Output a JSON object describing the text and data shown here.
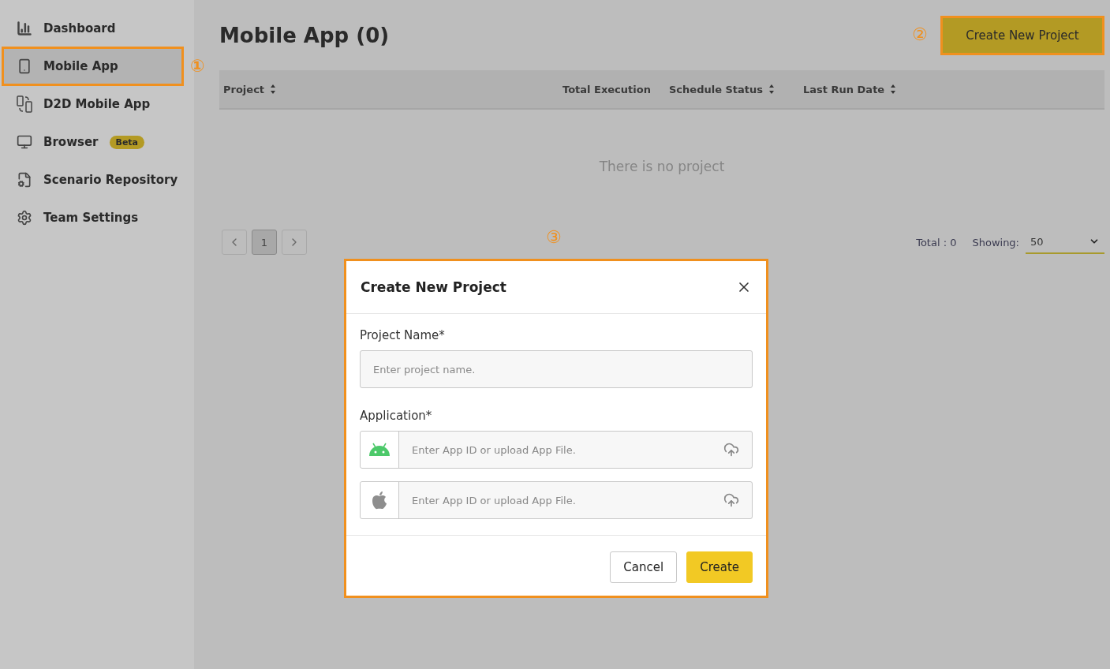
{
  "sidebar": {
    "items": [
      {
        "kind": "dashboard",
        "label": "Dashboard",
        "selected": false,
        "highlighted": false
      },
      {
        "kind": "mobile",
        "label": "Mobile App",
        "selected": true,
        "highlighted": true,
        "marker": "①"
      },
      {
        "kind": "d2d",
        "label": "D2D Mobile App",
        "selected": false,
        "highlighted": false
      },
      {
        "kind": "browser",
        "label": "Browser",
        "badge": "Beta",
        "selected": false,
        "highlighted": false
      },
      {
        "kind": "scenario",
        "label": "Scenario Repository",
        "selected": false,
        "highlighted": false
      },
      {
        "kind": "settings",
        "label": "Team Settings",
        "selected": false,
        "highlighted": false
      }
    ]
  },
  "page": {
    "title": "Mobile App (0)",
    "create_button": {
      "label": "Create New Project",
      "highlighted": true,
      "marker": "②"
    }
  },
  "table": {
    "columns": [
      {
        "label": "Project",
        "sortable": true
      },
      {
        "label": "Total Execution",
        "sortable": false
      },
      {
        "label": "Schedule Status",
        "sortable": true
      },
      {
        "label": "Last Run Date",
        "sortable": true
      }
    ],
    "empty_text": "There is no project"
  },
  "pagination": {
    "pages": [
      {
        "label": "1",
        "selected": true
      }
    ],
    "total": "Total : 0",
    "showing_label": "Showing:",
    "showing_value": "50"
  },
  "dialog": {
    "marker": "③",
    "highlighted": true,
    "title": "Create New Project",
    "fields": [
      {
        "label": "Project Name*",
        "inputs": [
          {
            "kind": "text",
            "placeholder": "Enter project name."
          }
        ]
      },
      {
        "label": "Application*",
        "inputs": [
          {
            "kind": "android",
            "placeholder": "Enter App ID or upload App File."
          },
          {
            "kind": "ios",
            "placeholder": "Enter App ID or upload App File."
          }
        ]
      }
    ],
    "buttons": [
      {
        "kind": "secondary",
        "label": "Cancel"
      },
      {
        "kind": "primary",
        "label": "Create"
      }
    ]
  }
}
